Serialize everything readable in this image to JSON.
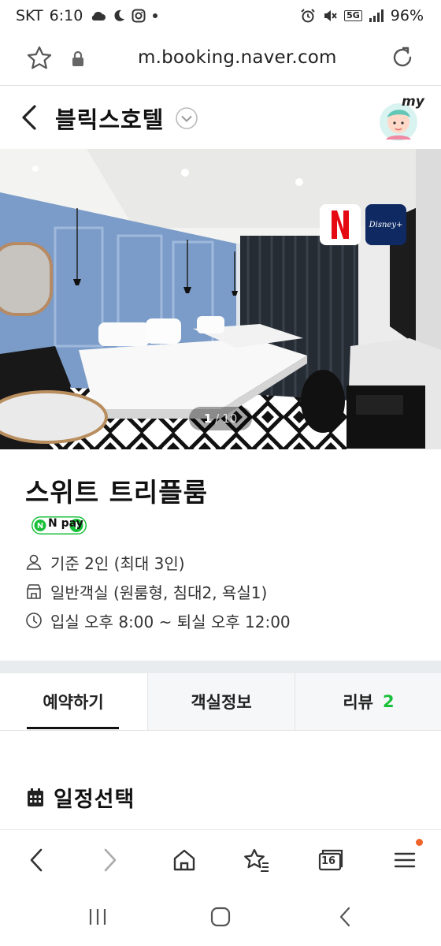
{
  "status_bar": {
    "carrier": "SKT",
    "time": "6:10",
    "network": "5G",
    "battery": "96%"
  },
  "browser": {
    "url": "m.booking.naver.com",
    "tab_count": "16"
  },
  "header": {
    "hotel_name": "블릭스호텔",
    "my_badge": "my"
  },
  "gallery": {
    "counter_current": "1",
    "counter_total": "10",
    "badges": [
      "netflix-logo",
      "disney-plus-logo"
    ],
    "disney_label": "Disney+"
  },
  "room": {
    "title": "스위트 트리플룸",
    "npay_label": "N pay",
    "info": [
      {
        "icon": "person-icon",
        "text": "기준 2인 (최대 3인)"
      },
      {
        "icon": "building-icon",
        "text": "일반객실 (원룸형, 침대2, 욕실1)"
      },
      {
        "icon": "clock-icon",
        "text": "입실 오후 8:00 ~ 퇴실 오후 12:00"
      }
    ]
  },
  "tabs": {
    "book": "예약하기",
    "room_info": "객실정보",
    "review": "리뷰",
    "review_count": "2"
  },
  "section": {
    "schedule_title": "일정선택"
  },
  "colors": {
    "accent_green": "#19c03a",
    "netflix_red": "#e50914",
    "disney_blue": "#0f2a63",
    "tab_bg": "#f5f7f8",
    "notification_dot": "#f0642b"
  }
}
